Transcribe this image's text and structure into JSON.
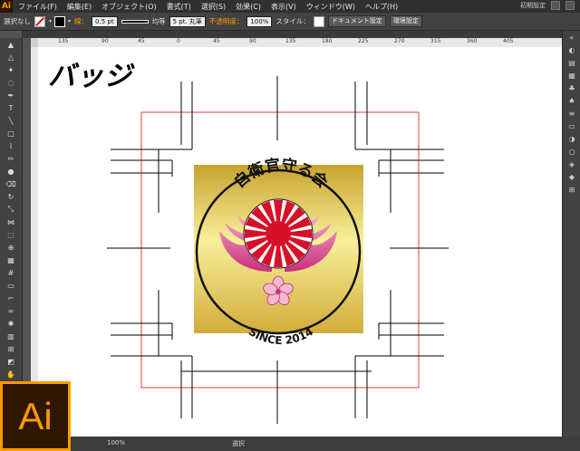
{
  "app": {
    "logo_text": "Ai",
    "big_logo_text": "Ai",
    "accent": "#ff9a00"
  },
  "menu": {
    "items": [
      "ファイル(F)",
      "編集(E)",
      "オブジェクト(O)",
      "書式(T)",
      "選択(S)",
      "効果(C)",
      "表示(V)",
      "ウィンドウ(W)",
      "ヘルプ(H)"
    ],
    "workspace": "初期設定"
  },
  "control": {
    "selection": "選択なし",
    "stroke_label": "線：",
    "stroke_width": "0.5 pt",
    "profile": "均等",
    "brush": "5 pt. 丸筆",
    "opacity_label": "不透明度：",
    "opacity": "100%",
    "style_label": "スタイル：",
    "doc_settings": "ドキュメント設定",
    "preferences": "環境設定"
  },
  "ruler": {
    "ticks": [
      "135",
      "90",
      "45",
      "0",
      "45",
      "90",
      "135",
      "180",
      "225",
      "270",
      "315",
      "360",
      "405"
    ]
  },
  "canvas": {
    "title": "バッジ",
    "badge_top_text": "自衛官守る会",
    "badge_bottom_text": "SINCE 2014"
  },
  "status": {
    "zoom": "100%",
    "tool": "選択"
  }
}
